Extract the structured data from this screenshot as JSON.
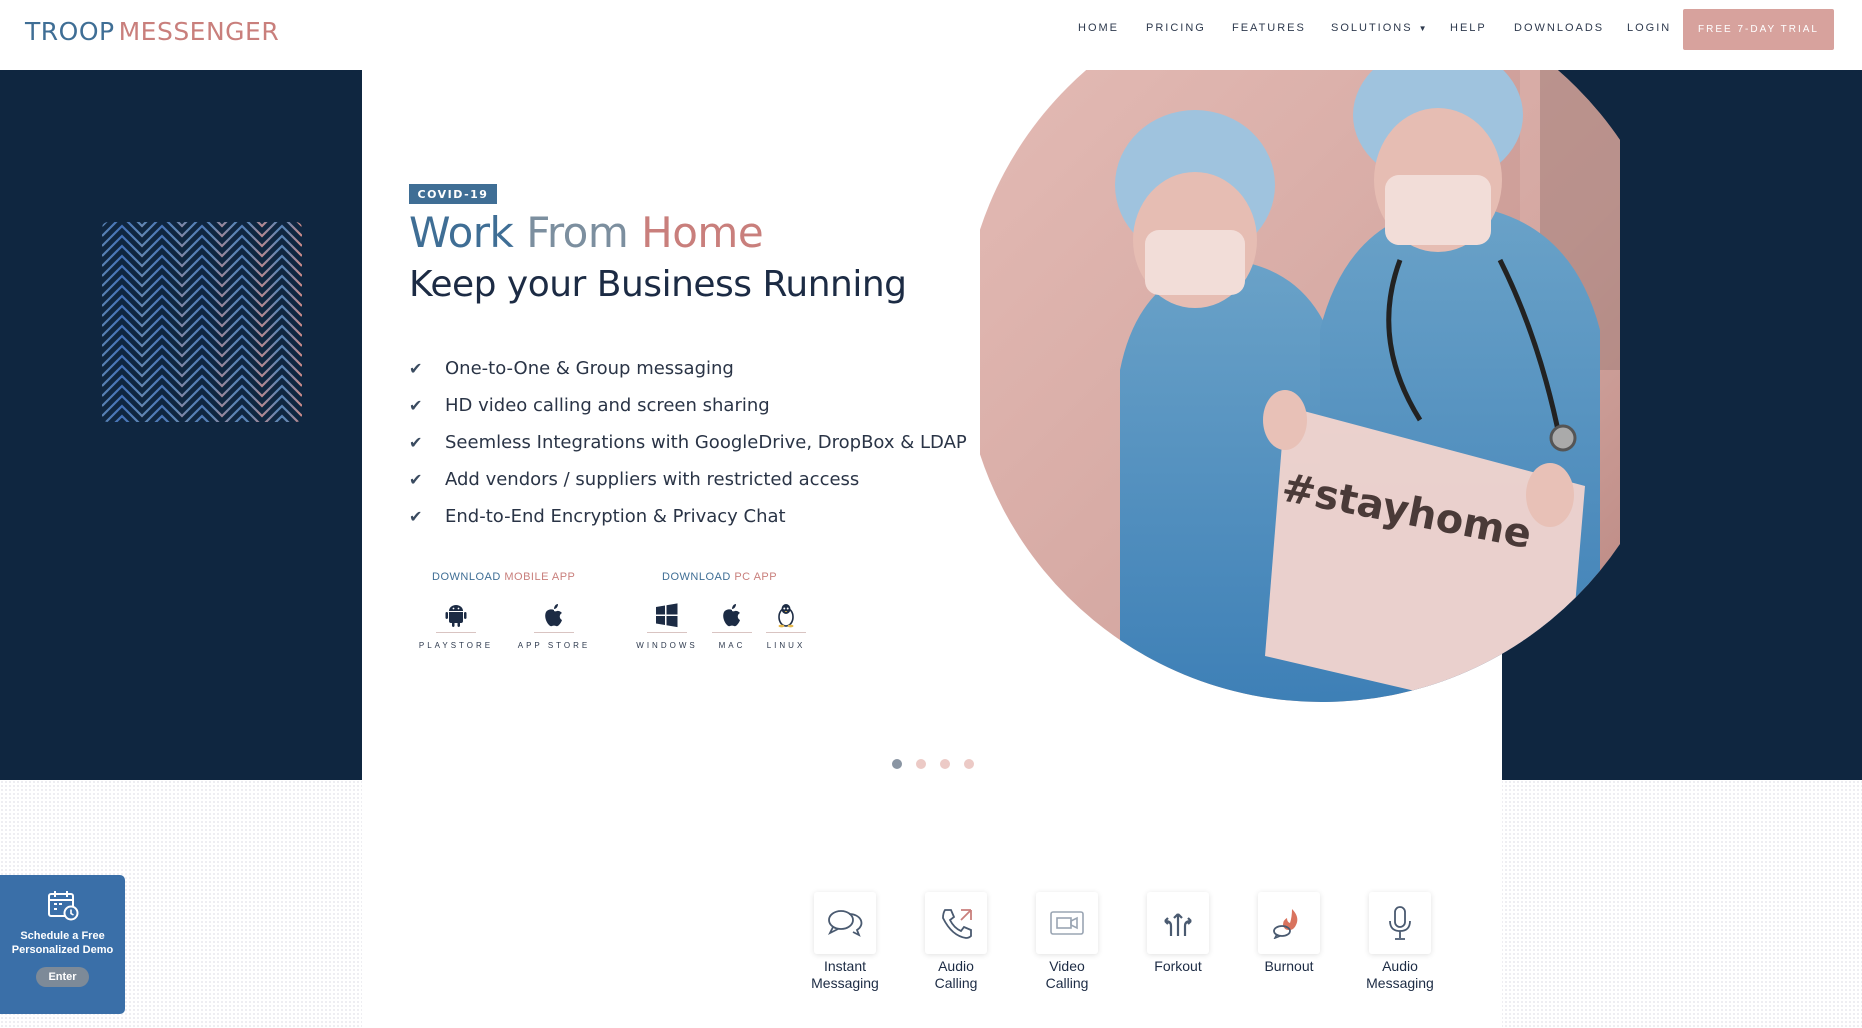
{
  "brand": {
    "part1": "TROOP",
    "part2": "MESSENGER",
    "color_primary": "#3f6e95",
    "color_accent": "#c97f7c",
    "color_dark": "#0f2640"
  },
  "nav": {
    "home": "HOME",
    "pricing": "PRICING",
    "features": "FEATURES",
    "solutions": "SOLUTIONS",
    "help": "HELP",
    "downloads": "DOWNLOADS",
    "login": "LOGIN",
    "trial": "FREE 7-DAY TRIAL"
  },
  "hero": {
    "badge": "COVID-19",
    "title": {
      "w1": "Work",
      "w2": "From",
      "w3": "Home"
    },
    "subtitle": "Keep your Business Running",
    "features": [
      "One-to-One & Group messaging",
      "HD video calling and screen sharing",
      "Seemless Integrations with GoogleDrive, DropBox & LDAP",
      "Add vendors / suppliers with restricted access",
      "End-to-End Encryption & Privacy Chat"
    ],
    "download_mobile": {
      "a": "DOWNLOAD",
      "b": "MOBILE APP"
    },
    "download_pc": {
      "a": "DOWNLOAD",
      "b": "PC APP"
    },
    "stores": {
      "playstore": "PLAYSTORE",
      "appstore": "APP STORE",
      "windows": "WINDOWS",
      "mac": "MAC",
      "linux": "LINUX"
    },
    "sign_text": "#stayhome",
    "slides": 4,
    "active_slide": 1
  },
  "services": [
    {
      "line1": "Instant",
      "line2": "Messaging",
      "icon": "chat-bubbles-icon"
    },
    {
      "line1": "Audio",
      "line2": "Calling",
      "icon": "phone-icon"
    },
    {
      "line1": "Video",
      "line2": "Calling",
      "icon": "video-icon"
    },
    {
      "line1": "Forkout",
      "line2": "",
      "icon": "forkout-icon"
    },
    {
      "line1": "Burnout",
      "line2": "",
      "icon": "burnout-icon"
    },
    {
      "line1": "Audio",
      "line2": "Messaging",
      "icon": "microphone-icon"
    }
  ],
  "demo": {
    "line1": "Schedule a Free",
    "line2": "Personalized Demo",
    "button": "Enter"
  }
}
